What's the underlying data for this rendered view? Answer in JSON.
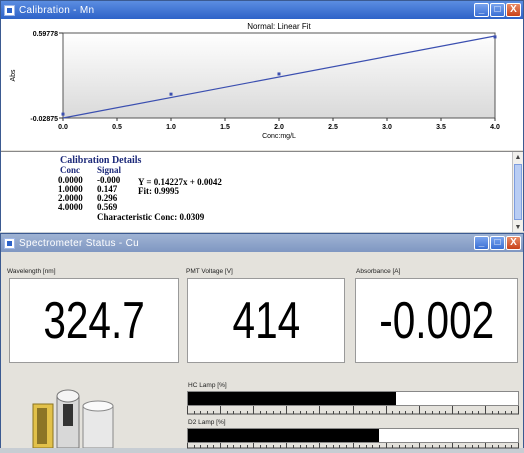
{
  "calibration": {
    "title": "Calibration - Mn",
    "chart_title": "Normal: Linear Fit",
    "details_header": "Calibration Details",
    "col_conc": "Conc",
    "col_signal": "Signal",
    "rows": [
      {
        "conc": "0.0000",
        "signal": "-0.000"
      },
      {
        "conc": "1.0000",
        "signal": "0.147"
      },
      {
        "conc": "2.0000",
        "signal": "0.296"
      },
      {
        "conc": "4.0000",
        "signal": "0.569"
      }
    ],
    "equation": "Y = 0.14227x + 0.0042",
    "fit": "Fit: 0.9995",
    "characteristic": "Characteristic Conc: 0.0309"
  },
  "chart_data": {
    "type": "line",
    "title": "Normal: Linear Fit",
    "xlabel": "Conc:mg/L",
    "ylabel": "Abs",
    "xlim": [
      0.0,
      4.0
    ],
    "ylim": [
      -0.02875,
      0.59778
    ],
    "x_ticks": [
      "0.0",
      "0.5",
      "1.0",
      "1.5",
      "2.0",
      "2.5",
      "3.0",
      "3.5",
      "4.0"
    ],
    "y_ticks": [
      "0.59778",
      "-0.02875"
    ],
    "points": [
      {
        "x": 0.0,
        "y": 0.0
      },
      {
        "x": 1.0,
        "y": 0.147
      },
      {
        "x": 2.0,
        "y": 0.296
      },
      {
        "x": 4.0,
        "y": 0.569
      }
    ],
    "fit_line": {
      "x0": 0.0,
      "y0": -0.02875,
      "x1": 4.0,
      "y1": 0.5755
    },
    "color": "#3b4fb0",
    "grid": false
  },
  "spectrometer": {
    "title": "Spectrometer Status - Cu",
    "wavelength_label": "Wavelength [nm]",
    "wavelength_value": "324.7",
    "pmt_label": "PMT Voltage [V]",
    "pmt_value": "414",
    "absorbance_label": "Absorbance [A]",
    "absorbance_value": "-0.002",
    "hc_lamp_label": "HC Lamp [%]",
    "hc_lamp_fraction": 0.63,
    "d2_lamp_label": "D2 Lamp [%]",
    "d2_lamp_fraction": 0.58
  },
  "window_controls": {
    "minimize": "_",
    "maximize": "□",
    "close": "X"
  }
}
